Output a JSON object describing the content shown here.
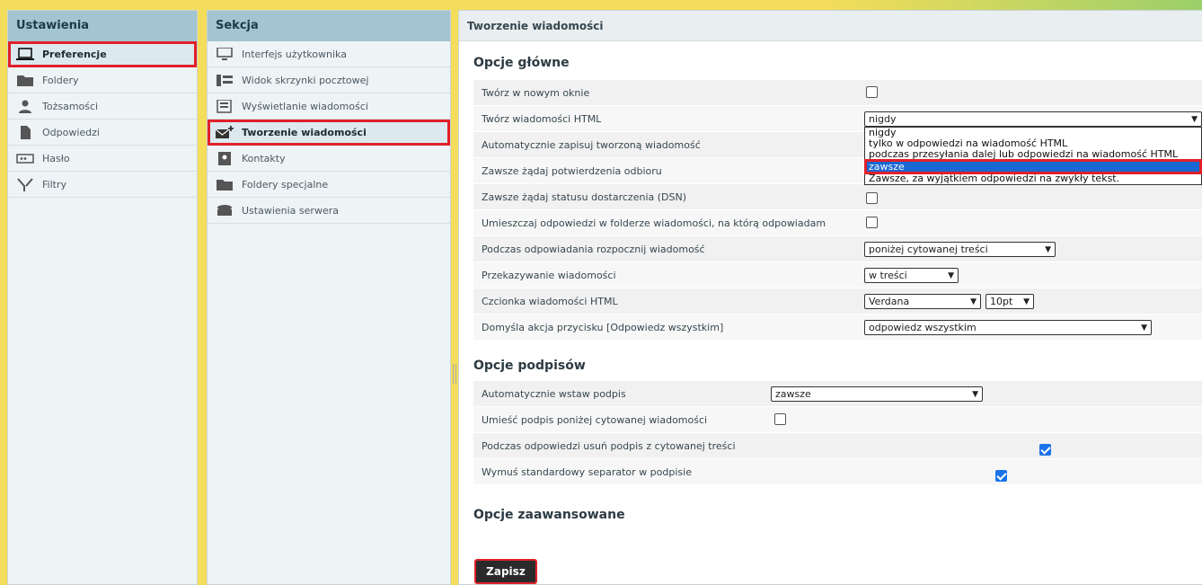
{
  "settings_panel": {
    "title": "Ustawienia",
    "items": [
      {
        "label": "Preferencje",
        "icon": "laptop-icon"
      },
      {
        "label": "Foldery",
        "icon": "folder-icon"
      },
      {
        "label": "Tożsamości",
        "icon": "person-icon"
      },
      {
        "label": "Odpowiedzi",
        "icon": "document-icon"
      },
      {
        "label": "Hasło",
        "icon": "password-icon"
      },
      {
        "label": "Filtry",
        "icon": "filter-icon"
      }
    ]
  },
  "section_panel": {
    "title": "Sekcja",
    "items": [
      {
        "label": "Interfejs użytkownika",
        "icon": "monitor-icon"
      },
      {
        "label": "Widok skrzynki pocztowej",
        "icon": "list-icon"
      },
      {
        "label": "Wyświetlanie wiadomości",
        "icon": "message-view-icon"
      },
      {
        "label": "Tworzenie wiadomości",
        "icon": "compose-icon"
      },
      {
        "label": "Kontakty",
        "icon": "contacts-icon"
      },
      {
        "label": "Foldery specjalne",
        "icon": "folder-icon"
      },
      {
        "label": "Ustawienia serwera",
        "icon": "server-icon"
      }
    ]
  },
  "main": {
    "title": "Tworzenie wiadomości",
    "main_options": {
      "heading": "Opcje główne",
      "rows": [
        {
          "label": "Twórz w nowym oknie",
          "type": "checkbox",
          "checked": false
        },
        {
          "label": "Twórz wiadomości HTML",
          "type": "select",
          "value": "nigdy"
        },
        {
          "label": "Automatycznie zapisuj tworzoną wiadomość"
        },
        {
          "label": "Zawsze żądaj potwierdzenia odbioru"
        },
        {
          "label": "Zawsze żądaj statusu dostarczenia (DSN)",
          "type": "checkbox",
          "checked": false
        },
        {
          "label": "Umieszczaj odpowiedzi w folderze wiadomości, na którą odpowiadam",
          "type": "checkbox",
          "checked": false
        },
        {
          "label": "Podczas odpowiadania rozpocznij wiadomość",
          "type": "select",
          "value": "poniżej cytowanej treści"
        },
        {
          "label": "Przekazywanie wiadomości",
          "type": "select",
          "value": "w treści"
        },
        {
          "label": "Czcionka wiadomości HTML",
          "type": "select",
          "value": "Verdana",
          "value2": "10pt"
        },
        {
          "label": "Domyśla akcja przycisku [Odpowiedz wszystkim]",
          "type": "select",
          "value": "odpowiedz wszystkim"
        }
      ],
      "html_dropdown_options": [
        "nigdy",
        "tylko w odpowiedzi na wiadomość HTML",
        "podczas przesyłania dalej lub odpowiedzi na wiadomość HTML",
        "zawsze",
        "Zawsze, za wyjątkiem odpowiedzi na zwykły tekst."
      ]
    },
    "signature_options": {
      "heading": "Opcje podpisów",
      "rows": [
        {
          "label": "Automatycznie wstaw podpis",
          "type": "select",
          "value": "zawsze"
        },
        {
          "label": "Umieść podpis poniżej cytowanej wiadomości",
          "type": "checkbox",
          "checked": false
        },
        {
          "label": "Podczas odpowiedzi usuń podpis z cytowanej treści",
          "type": "checkbox",
          "checked": true
        },
        {
          "label": "Wymuś standardowy separator w podpisie",
          "type": "checkbox",
          "checked": true
        }
      ]
    },
    "advanced_heading": "Opcje zaawansowane",
    "save_label": "Zapisz"
  },
  "colors": {
    "accent": "#1967d2",
    "highlight": "#e0202a",
    "header": "#a3c4d1"
  }
}
